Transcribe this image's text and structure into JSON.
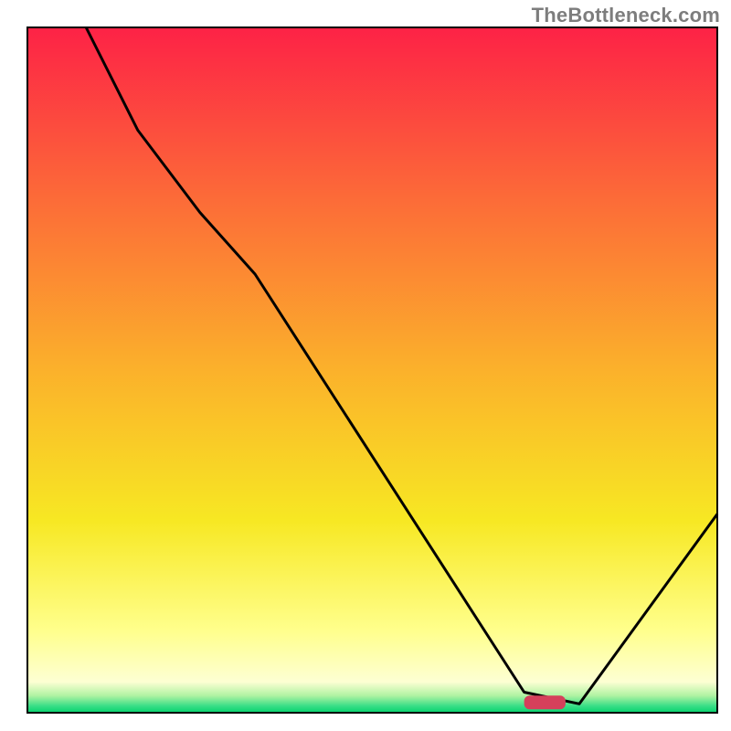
{
  "attribution": "TheBottleneck.com",
  "chart_data": {
    "type": "line",
    "title": "",
    "xlabel": "",
    "ylabel": "",
    "xlim": [
      0,
      100
    ],
    "ylim": [
      0,
      100
    ],
    "grid": false,
    "background_gradient": {
      "stops": [
        {
          "offset": 0.0,
          "color": "#fd2246"
        },
        {
          "offset": 0.25,
          "color": "#fc6b38"
        },
        {
          "offset": 0.5,
          "color": "#fbb12b"
        },
        {
          "offset": 0.72,
          "color": "#f7e823"
        },
        {
          "offset": 0.88,
          "color": "#ffff8c"
        },
        {
          "offset": 0.955,
          "color": "#fdffd3"
        },
        {
          "offset": 0.975,
          "color": "#b0f3a2"
        },
        {
          "offset": 0.99,
          "color": "#3ade87"
        },
        {
          "offset": 1.0,
          "color": "#06d36e"
        }
      ]
    },
    "marker": {
      "x": 75,
      "y": 1.5,
      "width": 6,
      "height": 2,
      "color": "#d5405b"
    },
    "series": [
      {
        "name": "bottleneck-curve",
        "color": "#000000",
        "x": [
          8.5,
          16,
          25,
          33,
          72,
          80,
          100
        ],
        "y": [
          100,
          85,
          73,
          64,
          3,
          1.3,
          29
        ]
      }
    ]
  }
}
